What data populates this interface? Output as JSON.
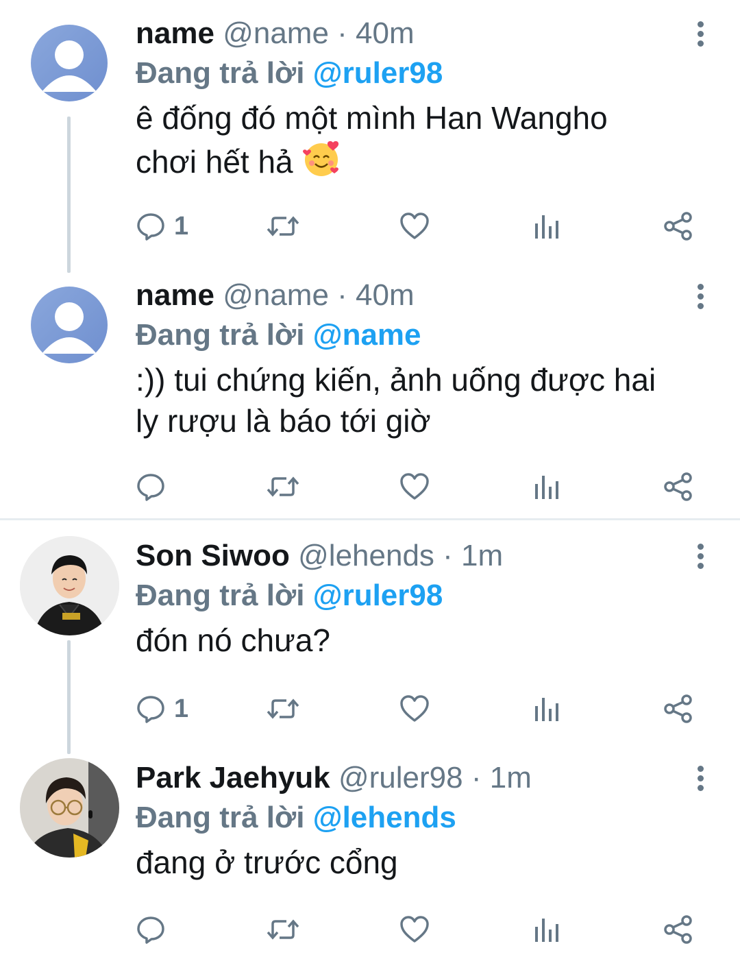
{
  "tweets": [
    {
      "display_name": "name",
      "handle": "@name",
      "separator": "·",
      "time": "40m",
      "reply_prefix": "Đang trả lời",
      "reply_to": "@ruler98",
      "text_line1": "ê đống đó một mình Han Wangho",
      "text_line2": "chơi hết hả",
      "reply_count": "1"
    },
    {
      "display_name": "name",
      "handle": "@name",
      "separator": "·",
      "time": "40m",
      "reply_prefix": "Đang trả lời",
      "reply_to": "@name",
      "text_line1": ":)) tui chứng kiến, ảnh uống được hai",
      "text_line2": "ly rượu là báo tới giờ",
      "reply_count": ""
    },
    {
      "display_name": "Son Siwoo",
      "handle": "@lehends",
      "separator": "·",
      "time": "1m",
      "reply_prefix": "Đang trả lời",
      "reply_to": "@ruler98",
      "text_line1": "đón nó chưa?",
      "text_line2": "",
      "reply_count": "1"
    },
    {
      "display_name": "Park Jaehyuk",
      "handle": "@ruler98",
      "separator": "·",
      "time": "1m",
      "reply_prefix": "Đang trả lời",
      "reply_to": "@lehends",
      "text_line1": "đang ở trước cổng",
      "text_line2": "",
      "reply_count": ""
    }
  ],
  "colors": {
    "accent": "#1da1f2",
    "secondary_text": "#657786",
    "primary_text": "#14171a",
    "divider": "#e6ecf0"
  },
  "icons": [
    "reply-icon",
    "retweet-icon",
    "like-icon",
    "analytics-icon",
    "share-icon",
    "more-icon",
    "smiling-face-with-hearts-emoji"
  ]
}
